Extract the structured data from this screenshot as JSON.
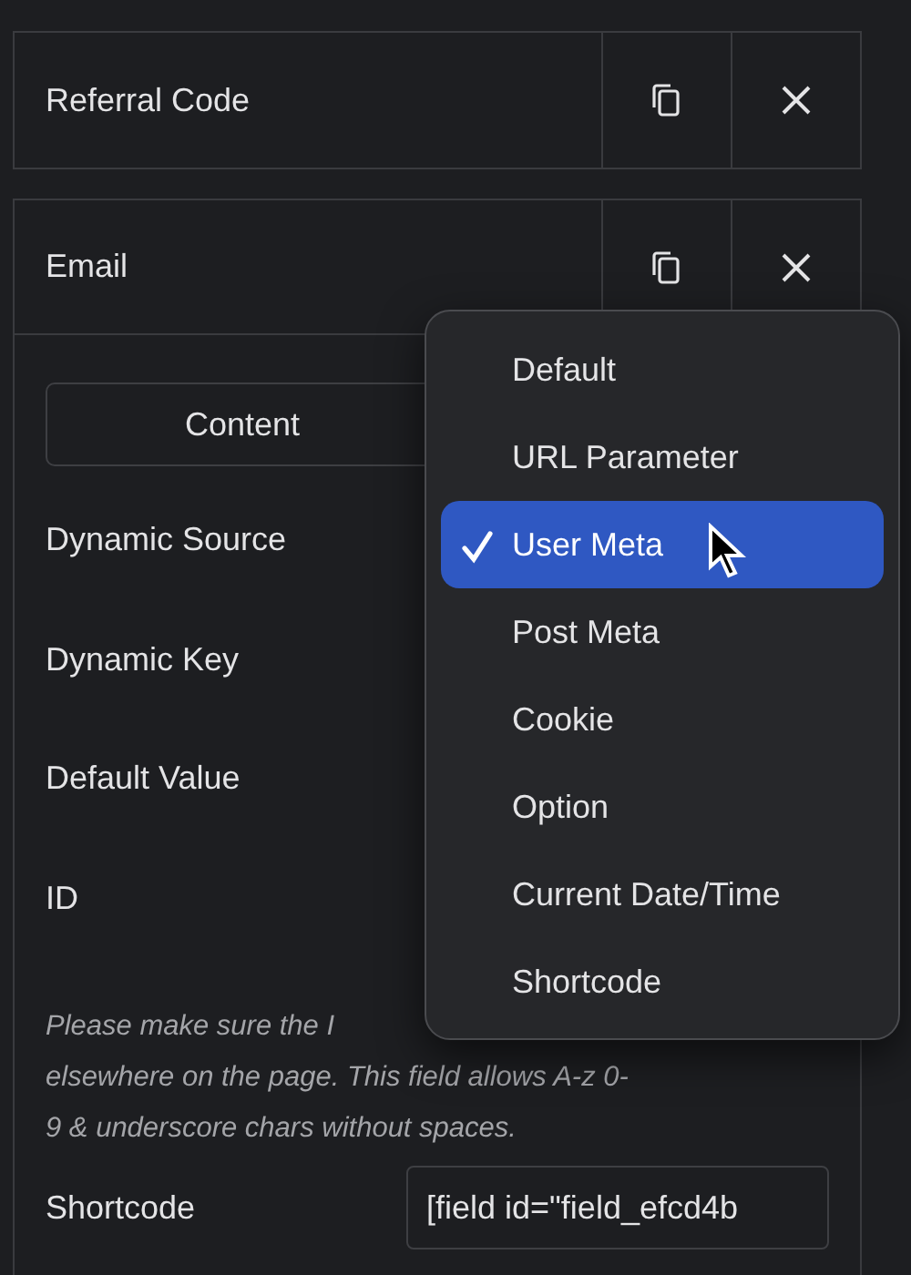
{
  "fields": [
    {
      "title": "Referral Code",
      "expanded": false
    },
    {
      "title": "Email",
      "expanded": true
    }
  ],
  "tabs": [
    {
      "label": "Content",
      "selected": false
    }
  ],
  "settings": [
    {
      "label": "Dynamic Source"
    },
    {
      "label": "Dynamic Key"
    },
    {
      "label": "Default Value"
    },
    {
      "label": "ID"
    }
  ],
  "note_lines": [
    "Please make sure the I",
    "elsewhere on the page. This field allows A-z  0-",
    "9 & underscore chars without spaces."
  ],
  "shortcode": {
    "label": "Shortcode",
    "value": "[field id=\"field_efcd4b"
  },
  "menu": [
    {
      "label": "Default",
      "selected": false
    },
    {
      "label": "URL Parameter",
      "selected": false
    },
    {
      "label": "User Meta",
      "selected": true
    },
    {
      "label": "Post Meta",
      "selected": false
    },
    {
      "label": "Cookie",
      "selected": false
    },
    {
      "label": "Option",
      "selected": false
    },
    {
      "label": "Current Date/Time",
      "selected": false
    },
    {
      "label": "Shortcode",
      "selected": false
    }
  ]
}
